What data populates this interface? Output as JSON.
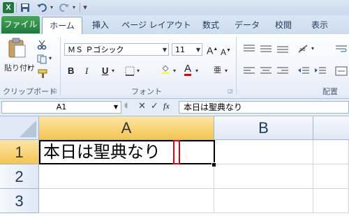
{
  "app": {
    "logo": "X"
  },
  "qat": {
    "dropdown": "▾"
  },
  "tabs": [
    "ファイル",
    "ホーム",
    "挿入",
    "ページ レイアウト",
    "数式",
    "データ",
    "校閲",
    "表示"
  ],
  "ribbon": {
    "paste_label": "貼り付け",
    "clipboard_group": "クリップボード",
    "font_name": "ＭＳ Ｐゴシック",
    "font_size": "11",
    "font_group": "フォント",
    "align_group": "配置",
    "bold": "B",
    "italic": "I",
    "underline": "U",
    "grow_font": "A",
    "shrink_font": "A",
    "font_color_letter": "A",
    "phonetic": "亜"
  },
  "formula_bar": {
    "name_box": "A1",
    "cancel": "✕",
    "enter": "✓",
    "fx": "fx",
    "content": "本日は聖典なり"
  },
  "grid": {
    "columns": [
      "A",
      "B"
    ],
    "rows": [
      "1",
      "2",
      "3"
    ],
    "cell_a1": "本日は聖典なり"
  },
  "colors": {
    "accent_green": "#1f7a3a",
    "selection_header": "#f5c54f",
    "cursor_highlight": "#e60012"
  }
}
